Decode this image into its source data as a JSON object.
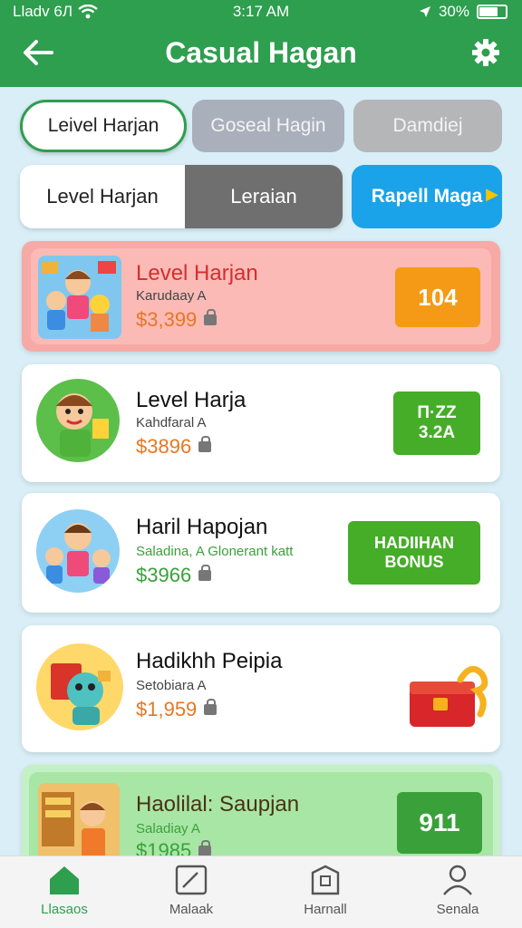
{
  "status": {
    "carrier": "Lladv 6Л",
    "time": "3:17 AM",
    "battery": "30%"
  },
  "header": {
    "title": "Casual Hagan"
  },
  "tabs": {
    "row1": [
      "Leivel Harjan",
      "Goseal Hagin",
      "Damdiej"
    ],
    "seg_left": "Level Harjan",
    "seg_right": "Leraian",
    "special": "Rapell Maga"
  },
  "cards": [
    {
      "title": "Level Harjan",
      "subtitle": "Karudaay A",
      "price": "$3,399",
      "badge": "104"
    },
    {
      "title": "Level Harja",
      "subtitle": "Kahdfaral A",
      "price": "$3896",
      "badge_line1": "П·ZZ",
      "badge_line2": "3.2A"
    },
    {
      "title": "Haril Hapojan",
      "subtitle": "Saladina, A Glonerant katt",
      "price": "$3966",
      "badge_line1": "HADIIHAN",
      "badge_line2": "BONUS"
    },
    {
      "title": "Hadikhh Peipia",
      "subtitle": "Setobiara A",
      "price": "$1,959"
    },
    {
      "title": "Haolilal: Saupjan",
      "subtitle": "Saladiay A",
      "price": "$1985",
      "badge": "911"
    }
  ],
  "nav": [
    "Llasaos",
    "Malaak",
    "Harnall",
    "Senala"
  ],
  "colors": {
    "brand_green": "#2e9e4f",
    "price_orange": "#e67722",
    "price_green": "#3aa13a",
    "badge_orange": "#f59a16",
    "badge_green": "#45ad27"
  }
}
